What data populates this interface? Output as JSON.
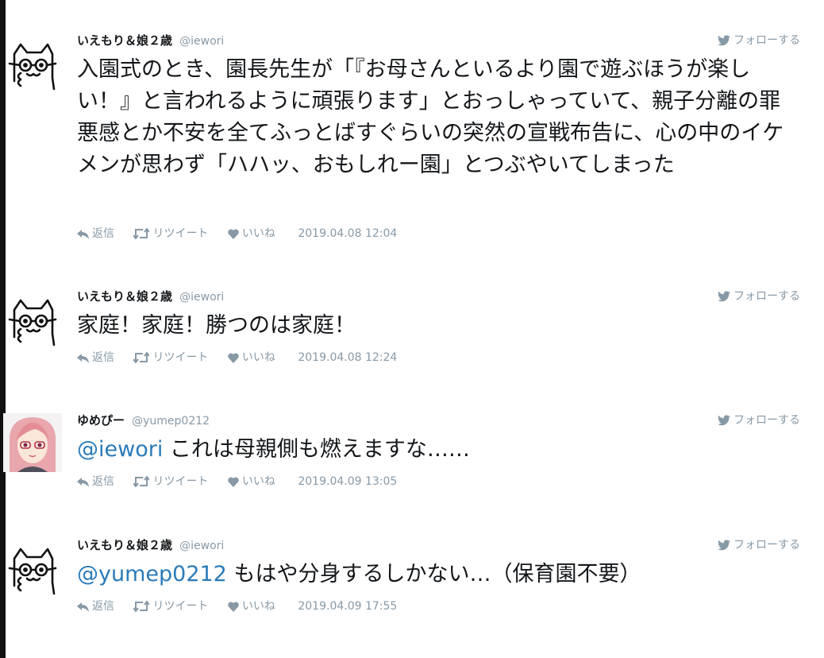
{
  "labels": {
    "follow": "フォローする",
    "reply": "返信",
    "retweet": "リツイート",
    "like": "いいね"
  },
  "colors": {
    "link": "#2b7bb9",
    "muted": "#8899a6",
    "text": "#14171a"
  },
  "tweets": [
    {
      "user": {
        "name": "いえもり＆娘２歳",
        "handle": "@iewori",
        "avatar": "cat-doodle-avatar"
      },
      "mention": "",
      "text": "入園式のとき、園長先生が「『お母さんといるより園で遊ぶほうが楽しい！』と言われるように頑張ります」とおっしゃっていて、親子分離の罪悪感とか不安を全てふっとばすぐらいの突然の宣戦布告に、心の中のイケメンが思わず「ハハッ、おもしれー園」とつぶやいてしまった",
      "timestamp": "2019.04.08 12:04"
    },
    {
      "user": {
        "name": "いえもり＆娘２歳",
        "handle": "@iewori",
        "avatar": "cat-doodle-avatar"
      },
      "mention": "",
      "text": "家庭！家庭！勝つのは家庭！",
      "timestamp": "2019.04.08 12:24"
    },
    {
      "user": {
        "name": "ゆめぴー",
        "handle": "@yumep0212",
        "avatar": "anime-girl-avatar"
      },
      "mention": "@iewori",
      "text": "これは母親側も燃えますな……",
      "timestamp": "2019.04.09 13:05"
    },
    {
      "user": {
        "name": "いえもり＆娘２歳",
        "handle": "@iewori",
        "avatar": "cat-doodle-avatar"
      },
      "mention": "@yumep0212",
      "text": "もはや分身するしかない…（保育園不要）",
      "timestamp": "2019.04.09 17:55"
    }
  ]
}
